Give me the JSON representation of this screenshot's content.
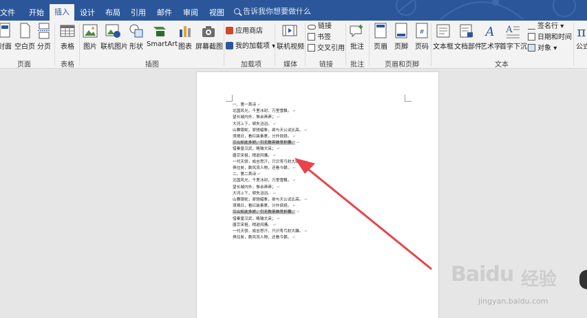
{
  "tabs": [
    {
      "label": "文件",
      "active": false
    },
    {
      "label": "开始",
      "active": false
    },
    {
      "label": "插入",
      "active": true
    },
    {
      "label": "设计",
      "active": false
    },
    {
      "label": "布局",
      "active": false
    },
    {
      "label": "引用",
      "active": false
    },
    {
      "label": "邮件",
      "active": false
    },
    {
      "label": "审阅",
      "active": false
    },
    {
      "label": "视图",
      "active": false
    }
  ],
  "tell_me": "告诉我你想要做什么",
  "ribbon": {
    "pages": {
      "cover": "封面",
      "blank": "空白页",
      "break": "分页",
      "group": "页面"
    },
    "table": {
      "table": "表格",
      "group": "表格"
    },
    "illustrations": {
      "picture": "图片",
      "online_picture": "联机图片",
      "shapes": "形状",
      "smartart": "SmartArt",
      "chart": "图表",
      "screenshot": "屏幕截图",
      "group": "插图"
    },
    "addins": {
      "store": "应用商店",
      "my_addins": "我的加载项",
      "group": "加载项"
    },
    "media": {
      "online_video": "联机视频",
      "group": "媒体"
    },
    "links": {
      "link": "链接",
      "bookmark": "书签",
      "cross_ref": "交叉引用",
      "group": "链接"
    },
    "comments": {
      "comment": "批注",
      "group": "批注"
    },
    "header_footer": {
      "header": "页眉",
      "footer": "页脚",
      "page_number": "页码",
      "group": "页眉和页脚"
    },
    "text": {
      "textbox": "文本框",
      "quick_parts": "文档部件",
      "wordart": "艺术字",
      "dropcap": "首字下沉",
      "signature": "签名行",
      "datetime": "日期和时间",
      "object": "对象",
      "group": "文本"
    },
    "symbols": {
      "equation": "公式"
    }
  },
  "document": {
    "lines": [
      "一、第一首诗",
      "北国风光，千里冰封，万里雪飘。",
      "望长城内外，惟余莽莽；",
      "大河上下，顿失滔滔。",
      "山舞银蛇，原驰蜡象，欲与天公试比高。",
      "须晴日，看红装素裹，分外妖娆。",
      "江山如此多娇，引无数英雄竞折腰。",
      "惜秦皇汉武，略输文采；",
      "唐宗宋祖，稍逊风骚。",
      "一代天骄，成吉思汗，只识弯弓射大雕。",
      "俱往矣，数风流人物，还看今朝。",
      "二、第二首诗",
      "北国风光，千里冰封，万里雪飘。",
      "望长城内外，惟余莽莽；",
      "大河上下，顿失滔滔。",
      "山舞银蛇，原驰蜡象，欲与天公试比高。",
      "须晴日，看红装素裹，分外妖娆。",
      "江山如此多娇，引无数英雄竞折腰。",
      "惜秦皇汉武，略输文采；",
      "唐宗宋祖，稍逊风骚。",
      "一代天骄，成吉思汗，只识弯弓射大雕。",
      "俱往矣，数风流人物，还看今朝。"
    ],
    "highlighted_line": "江山如此多娇，引无数英雄竞折腰。"
  },
  "watermark": {
    "brand": "Baidu",
    "brand_cn": "经验",
    "url": "jingyan.baidu.com"
  },
  "colors": {
    "accent": "#2b579a",
    "arrow": "#e8434a",
    "selection": "#c8c8c8"
  }
}
